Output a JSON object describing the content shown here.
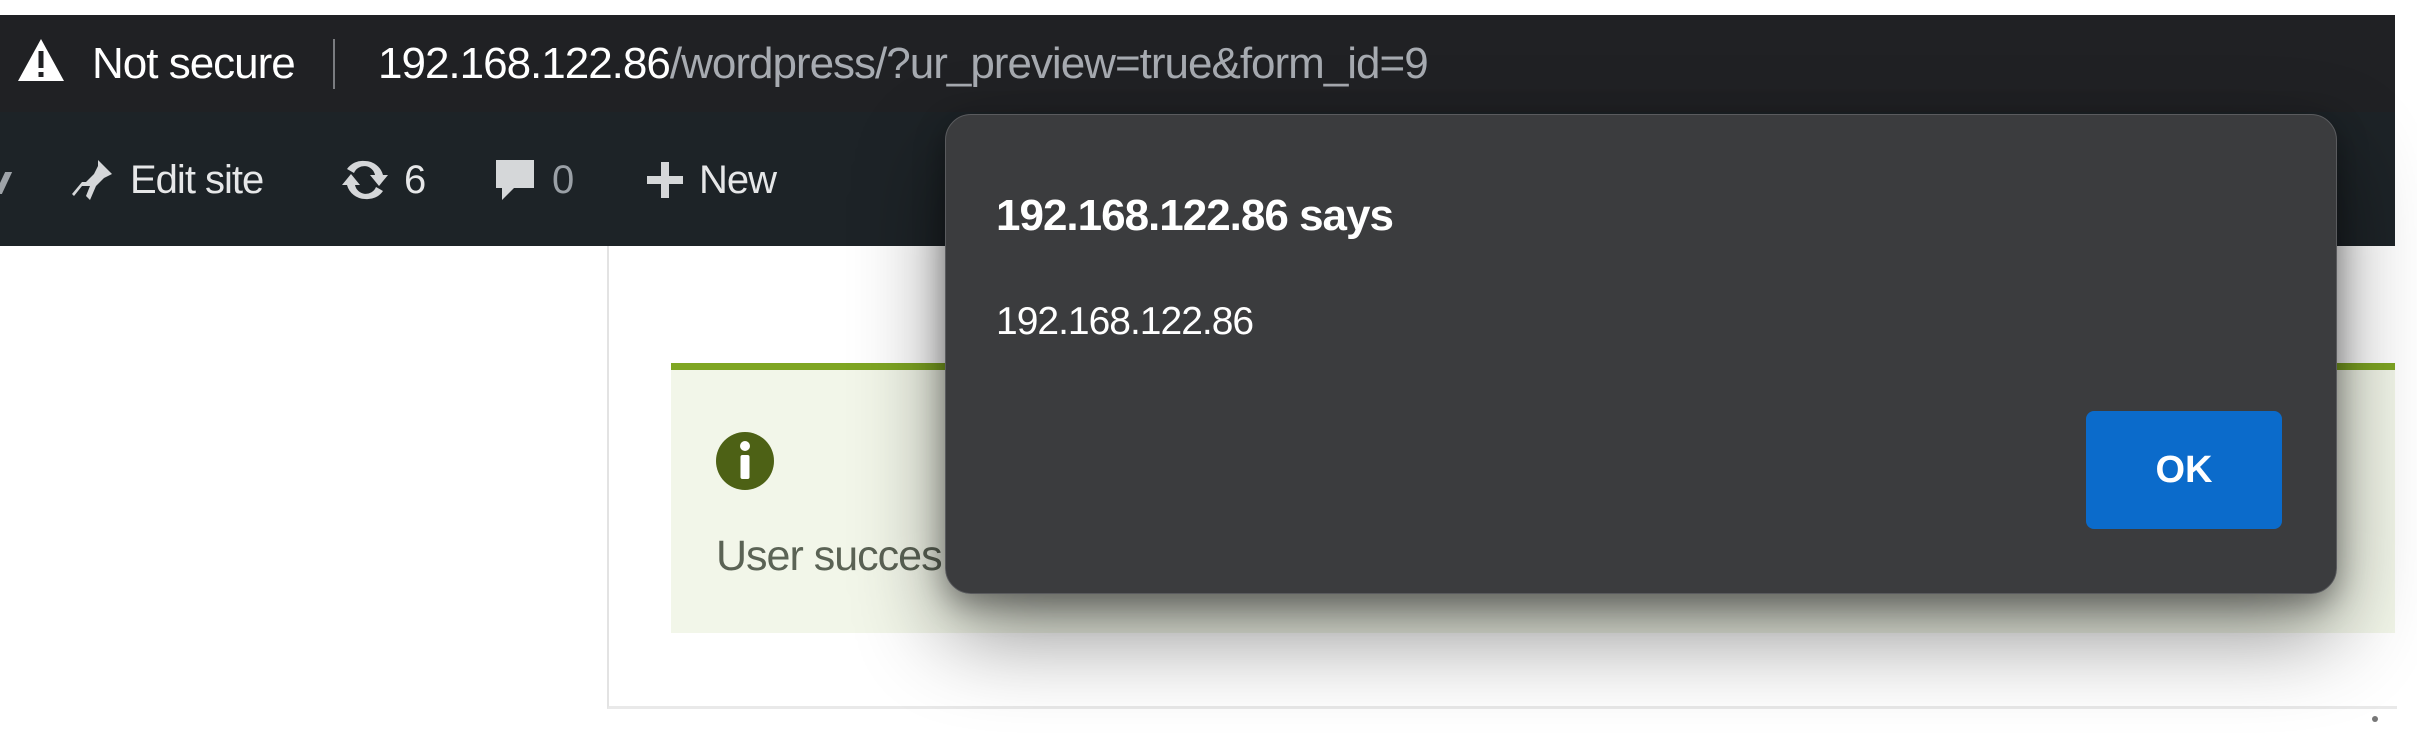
{
  "browser": {
    "security_label": "Not secure",
    "url_host": "192.168.122.86",
    "url_path": "/wordpress/?ur_preview=true&form_id=9",
    "warning_icon": "warning-triangle-icon"
  },
  "admin_bar": {
    "edit_site": {
      "label": "Edit site",
      "icon": "brush-icon"
    },
    "updates": {
      "count": "6",
      "icon": "updates-icon"
    },
    "comments": {
      "count": "0",
      "icon": "comment-icon"
    },
    "new": {
      "label": "New",
      "icon": "plus-icon"
    }
  },
  "notice": {
    "icon": "info-icon",
    "text": "User succes",
    "accent_color": "#7fa623"
  },
  "alert_dialog": {
    "title": "192.168.122.86 says",
    "message": "192.168.122.86",
    "ok_label": "OK",
    "ok_color": "#0b6bcb"
  }
}
